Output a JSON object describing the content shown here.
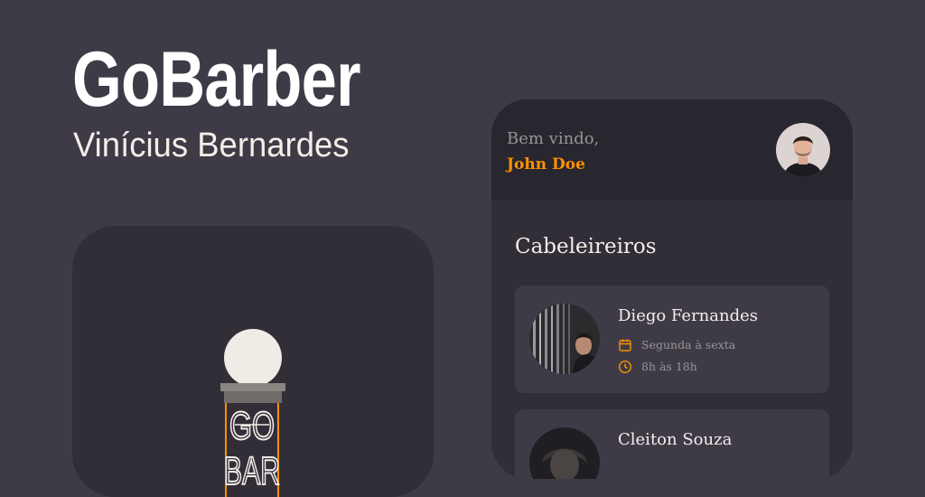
{
  "hero": {
    "title": "GoBarber",
    "author": "Vinícius Bernardes"
  },
  "logo": {
    "text_line1": "GO",
    "text_line2": "BAR"
  },
  "phone": {
    "header": {
      "welcome": "Bem vindo,",
      "user_name": "John Doe"
    },
    "section_title": "Cabeleireiros",
    "providers": [
      {
        "name": "Diego Fernandes",
        "days": "Segunda à sexta",
        "hours": "8h às 18h"
      },
      {
        "name": "Cleiton Souza"
      }
    ]
  },
  "colors": {
    "background": "#3e3b47",
    "card": "#312e38",
    "header": "#28262e",
    "accent": "#ff9000",
    "text": "#f4ede8",
    "muted": "#999591"
  },
  "icons": {
    "calendar": "calendar-icon",
    "clock": "clock-icon"
  }
}
